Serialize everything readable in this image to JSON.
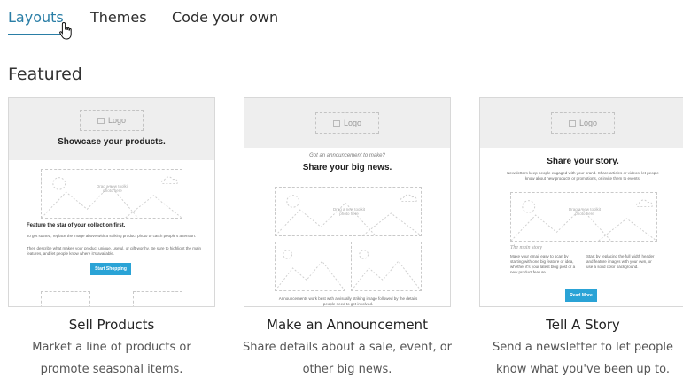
{
  "tabs": [
    {
      "label": "Layouts",
      "active": true
    },
    {
      "label": "Themes",
      "active": false
    },
    {
      "label": "Code your own",
      "active": false
    }
  ],
  "section_title": "Featured",
  "cards": [
    {
      "preview": {
        "logo": "Logo",
        "headline": "Showcase your products.",
        "placeholder": "Drag a new toolkit photo here",
        "feature_title": "Feature the star of your collection first.",
        "body_1": "To get started, replace the image above with a striking product photo to catch people's attention.",
        "body_2": "Then describe what makes your product unique, useful, or gift-worthy. Be sure to highlight the main features, and let people know where it's available.",
        "button": "Start Shopping"
      },
      "title": "Sell Products",
      "description_line_1": "Market a line of products or",
      "description_line_2": "promote seasonal items."
    },
    {
      "preview": {
        "logo": "Logo",
        "kicker": "Got an announcement to make?",
        "headline": "Share your big news.",
        "placeholder": "Drag a new toolkit photo here",
        "footer": "Announcements work best with a visually striking image followed by the details people need to get involved."
      },
      "title": "Make an Announcement",
      "description_line_1": "Share details about a sale, event, or",
      "description_line_2": "other big news."
    },
    {
      "preview": {
        "logo": "Logo",
        "headline": "Share your story.",
        "intro": "Newsletters keep people engaged with your brand. Share articles or videos, let people know about new products or promotions, or invite them to events.",
        "placeholder": "Drag a new toolkit photo here",
        "script": "The main story",
        "col_1": "Make your email easy to scan by starting with one big feature or idea, whether it's your latest blog post or a new product feature.",
        "col_2": "Start by replacing the full width header and feature images with your own, or use a solid color background.",
        "button": "Read More"
      },
      "title": "Tell A Story",
      "description_line_1": "Send a newsletter to let people",
      "description_line_2": "know what you've been up to."
    }
  ],
  "colors": {
    "accent": "#2a7ea6",
    "button": "#2aa3d6",
    "preview_header": "#eeeeee"
  }
}
